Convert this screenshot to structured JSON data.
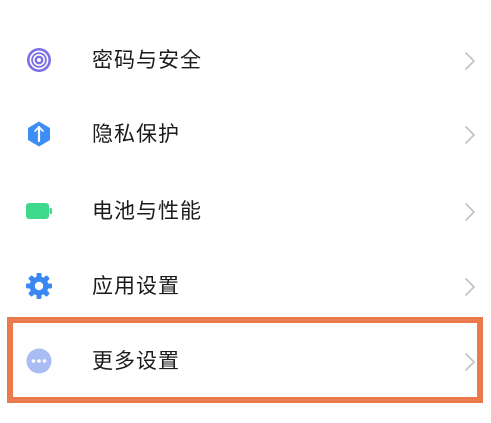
{
  "settings": {
    "items": [
      {
        "label": "密码与安全",
        "icon": "password-security-icon",
        "icon_color": "#7b6fe6"
      },
      {
        "label": "隐私保护",
        "icon": "privacy-shield-icon",
        "icon_color": "#3c8ef5"
      },
      {
        "label": "电池与性能",
        "icon": "battery-icon",
        "icon_color": "#3fd98d"
      },
      {
        "label": "应用设置",
        "icon": "app-settings-gear-icon",
        "icon_color": "#3a86f2"
      },
      {
        "label": "更多设置",
        "icon": "more-settings-icon",
        "icon_color": "#a9bdf2"
      }
    ]
  },
  "highlight": {
    "target": "更多设置",
    "color": "#ea7a4e"
  },
  "colors": {
    "text": "#1b1b1b",
    "chevron": "#c4c4c4",
    "background": "#ffffff"
  }
}
